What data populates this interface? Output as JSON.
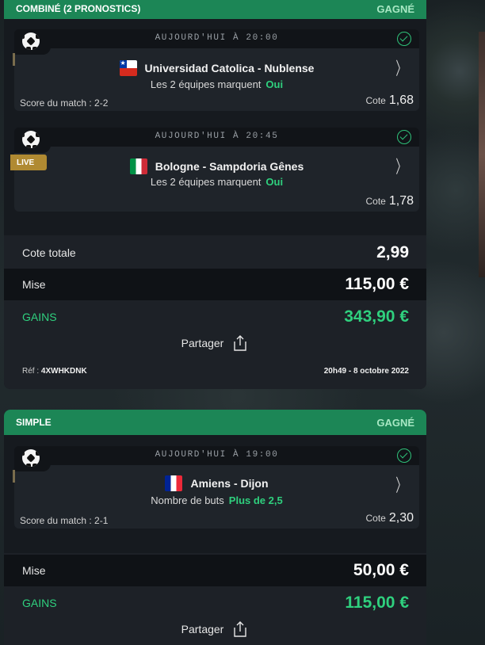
{
  "tickets": [
    {
      "type_label": "COMBINÉ (2 PRONOSTICS)",
      "status": "GAGNÉ",
      "matches": [
        {
          "time": "AUJOURD'HUI À 20:00",
          "teams": "Universidad Catolica - Nublense",
          "flag": "chile-flag",
          "bet_label": "Les 2 équipes marquent",
          "pick": "Oui",
          "score": "Score du match : 2-2",
          "cote_label": "Cote",
          "cote": "1,68",
          "live": ""
        },
        {
          "time": "AUJOURD'HUI À 20:45",
          "teams": "Bologne - Sampdoria Gênes",
          "flag": "italy-flag",
          "bet_label": "Les 2 équipes marquent",
          "pick": "Oui",
          "score": "",
          "cote_label": "Cote",
          "cote": "1,78",
          "live": "LIVE"
        }
      ],
      "cote_totale_label": "Cote totale",
      "cote_totale": "2,99",
      "mise_label": "Mise",
      "mise": "115,00 €",
      "gains_label": "GAINS",
      "gains": "343,90 €",
      "share_label": "Partager",
      "ref_label": "Réf :",
      "ref": "4XWHKDNK",
      "date": "20h49 - 8 octobre 2022"
    },
    {
      "type_label": "SIMPLE",
      "status": "GAGNÉ",
      "matches": [
        {
          "time": "AUJOURD'HUI À 19:00",
          "teams": "Amiens - Dijon",
          "flag": "france-flag",
          "bet_label": "Nombre de buts",
          "pick": "Plus de 2,5",
          "score": "Score du match : 2-1",
          "cote_label": "Cote",
          "cote": "2,30",
          "live": ""
        }
      ],
      "mise_label": "Mise",
      "mise": "50,00 €",
      "gains_label": "GAINS",
      "gains": "115,00 €",
      "share_label": "Partager"
    }
  ],
  "colors": {
    "header_green": "#1c8656",
    "win_green": "#2fd07e",
    "live_gold": "#b08a32"
  }
}
